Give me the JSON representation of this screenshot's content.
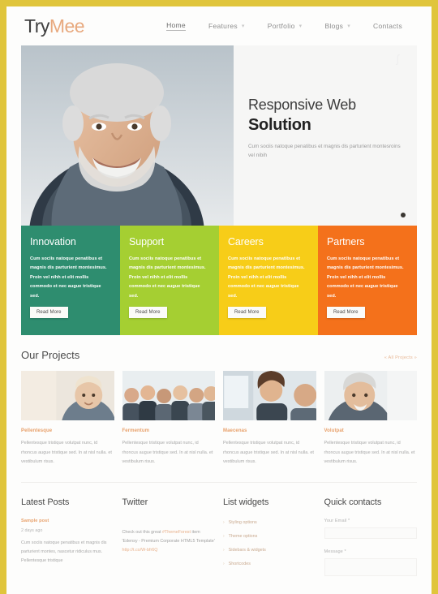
{
  "site": {
    "logo_part1": "Try",
    "logo_part2": "Mee"
  },
  "nav": {
    "items": [
      {
        "label": "Home",
        "has_caret": false,
        "active": true
      },
      {
        "label": "Features",
        "has_caret": true,
        "active": false
      },
      {
        "label": "Portfolio",
        "has_caret": true,
        "active": false
      },
      {
        "label": "Blogs",
        "has_caret": true,
        "active": false
      },
      {
        "label": "Contacts",
        "has_caret": false,
        "active": false
      }
    ],
    "caret_glyph": "▾"
  },
  "hero": {
    "heading_light": "Responsive Web",
    "heading_bold": "Solution",
    "paragraph": "Cum sociis natoque penatibus et magnis dis parturient montesroins vel nibih",
    "corner_mark": "ʃ"
  },
  "features": [
    {
      "title": "Innovation",
      "text": "Cum sociis natoque penatibus et magnis dis parturient montesimus. Proin vel nihh et elit mollis commodo et nec augue tristique sed.",
      "button": "Read More",
      "color": "#2e8d6f"
    },
    {
      "title": "Support",
      "text": "Cum sociis natoque penatibus et magnis dis parturient montesimus. Proin vel nihh et elit mollis commodo et nec augue tristique sed.",
      "button": "Read More",
      "color": "#a5cf32"
    },
    {
      "title": "Careers",
      "text": "Cum sociis natoque penatibus et magnis dis parturient montesimus. Proin vel nihh et elit mollis commodo et nec augue tristique sed.",
      "button": "Read More",
      "color": "#f7cd18"
    },
    {
      "title": "Partners",
      "text": "Cum sociis natoque penatibus et magnis dis parturient montesimus. Proin vel nihh et elit mollis commodo et nec augue tristique sed.",
      "button": "Read More",
      "color": "#f4711b"
    }
  ],
  "projects": {
    "heading": "Our Projects",
    "all_link": "« All Projects »",
    "items": [
      {
        "title": "Pellentesque",
        "desc": "Pellentesque tristique volutpat nunc, id rhoncus augue tristique sed. In at nisl nulla. et vestibulum risus."
      },
      {
        "title": "Fermentum",
        "desc": "Pellentesque tristique volutpat nunc, id rhoncus augue tristique sed. In at nisl nulla. et vestibulum risus."
      },
      {
        "title": "Maecenas",
        "desc": "Pellentesque tristique volutpat nunc, id rhoncus augue tristique sed. In at nisl nulla. et vestibulum risus."
      },
      {
        "title": "Volutpat",
        "desc": "Pellentesque tristique volutpat nunc, id rhoncus augue tristique sed. In at nisl nulla. et vestibulum risus."
      }
    ]
  },
  "footer": {
    "latest_posts": {
      "heading": "Latest Posts",
      "post_title": "Sample post",
      "post_meta": "2 days ago",
      "post_body": "Cum sociis natoque penatibus et magnis dis parturient montes, nascetur ridiculus mus. Pellentesque tristique"
    },
    "twitter": {
      "heading": "Twitter",
      "text_pre": "Check out this great",
      "hashtag": "#ThemeForest",
      "text_mid": "item 'Edensy - Premium Corporate HTML5 Template'",
      "link": "http://t.co/W-bfr6Q"
    },
    "list_widgets": {
      "heading": "List widgets",
      "bullet": "›",
      "items": [
        "Styling options",
        "Theme options",
        "Sidebars & widgets",
        "Shortcodes"
      ]
    },
    "quick_contacts": {
      "heading": "Quick contacts",
      "email_label": "Your Email *",
      "message_label": "Message *"
    }
  },
  "colors": {
    "page_border": "#e0c53c",
    "accent_orange": "#e8a06a",
    "logo_accent": "#e8a97e"
  }
}
